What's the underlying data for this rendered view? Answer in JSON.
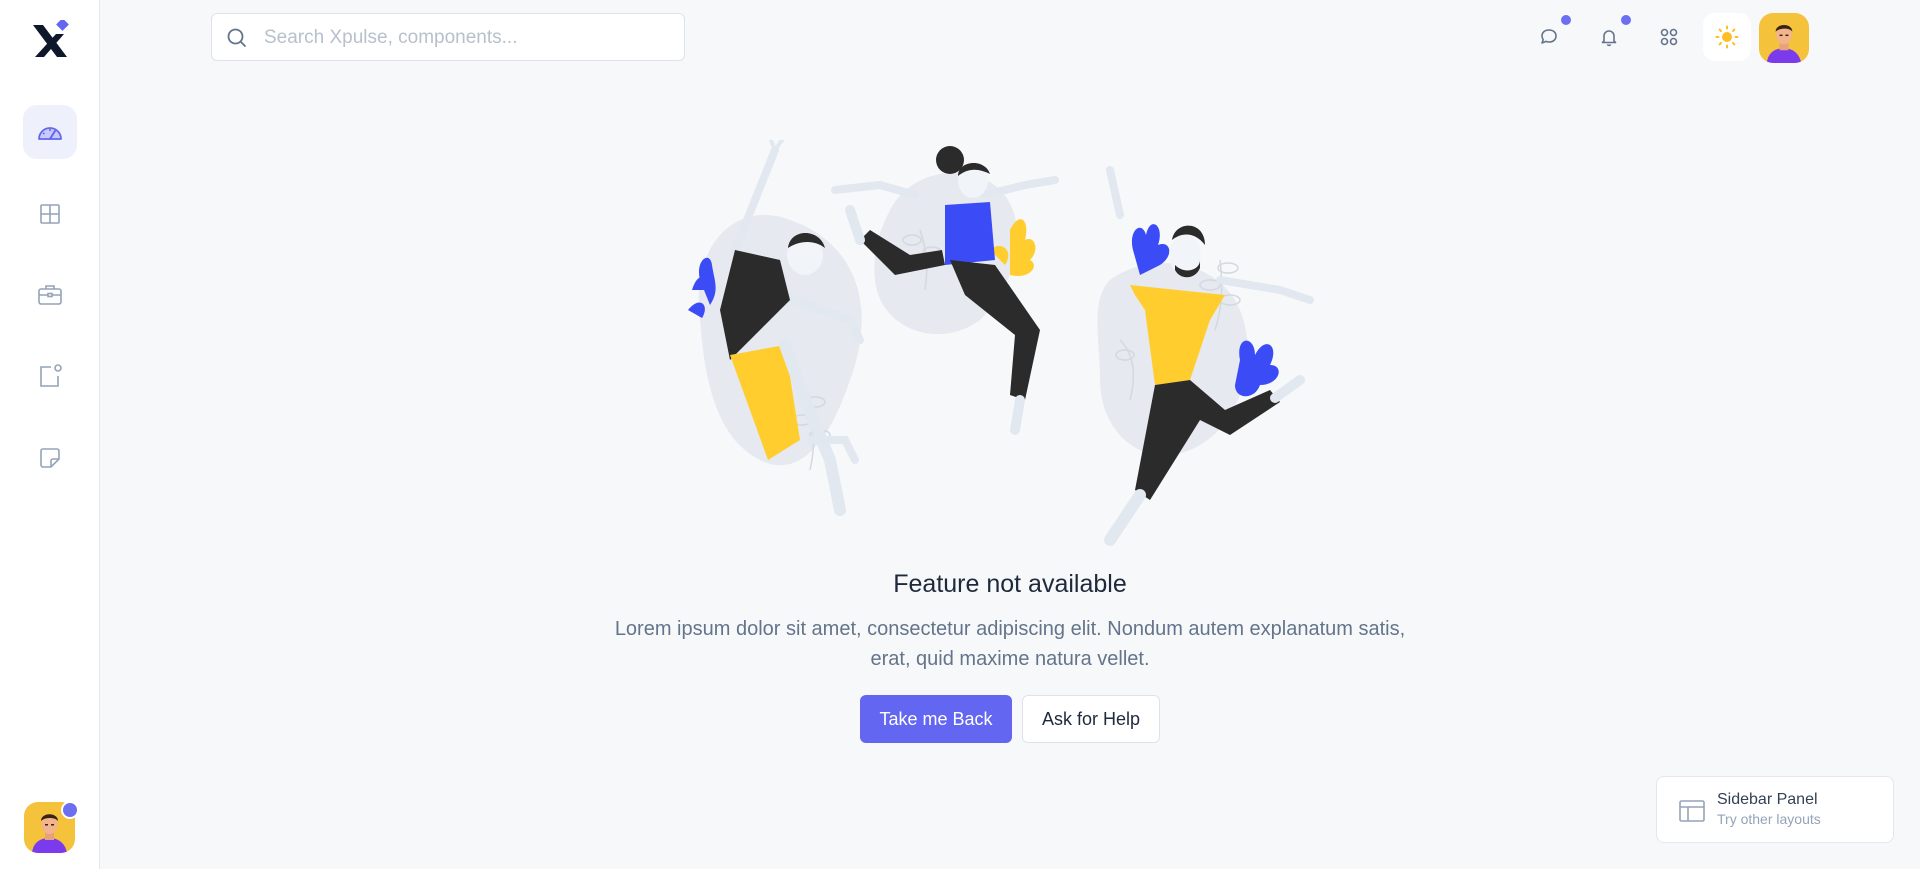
{
  "header": {
    "search_placeholder": "Search Xpulse, components..."
  },
  "icons": {
    "logo": "x-logo-icon",
    "sidebar": [
      "dashboard-gauge-icon",
      "grid-icon",
      "briefcase-icon",
      "notification-square-icon",
      "sticky-note-icon"
    ],
    "topbar": [
      "chat-icon",
      "bell-icon",
      "apps-icon",
      "sun-icon"
    ]
  },
  "colors": {
    "accent": "#6366f1",
    "illustration_blue": "#3b4cf6",
    "illustration_yellow": "#ffcd2e",
    "illustration_dark": "#2b2b2b"
  },
  "empty_state": {
    "title": "Feature not available",
    "description": "Lorem ipsum dolor sit amet, consectetur adipiscing elit. Nondum autem explanatum satis, erat, quid maxime natura vellet.",
    "primary_button": "Take me Back",
    "secondary_button": "Ask for Help"
  },
  "layout_switcher": {
    "title": "Sidebar Panel",
    "subtitle": "Try other layouts"
  }
}
